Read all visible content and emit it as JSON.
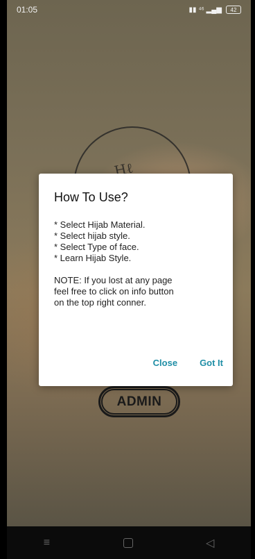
{
  "status_bar": {
    "time": "01:05",
    "signal_text": "▮▮ ⁴⁶ ▂▄▆",
    "battery": "42"
  },
  "background": {
    "admin_button": "ADMIN"
  },
  "dialog": {
    "title": "How To Use?",
    "steps": [
      "* Select Hijab Material.",
      "* Select hijab style.",
      "* Select Type of face.",
      "* Learn Hijab Style."
    ],
    "note_lines": [
      "NOTE: If you lost at any page",
      "feel free to click on info button",
      "on the top right conner."
    ],
    "close_label": "Close",
    "gotit_label": "Got It"
  },
  "nav_bar": {
    "menu_icon": "≡",
    "back_icon": "◁"
  }
}
